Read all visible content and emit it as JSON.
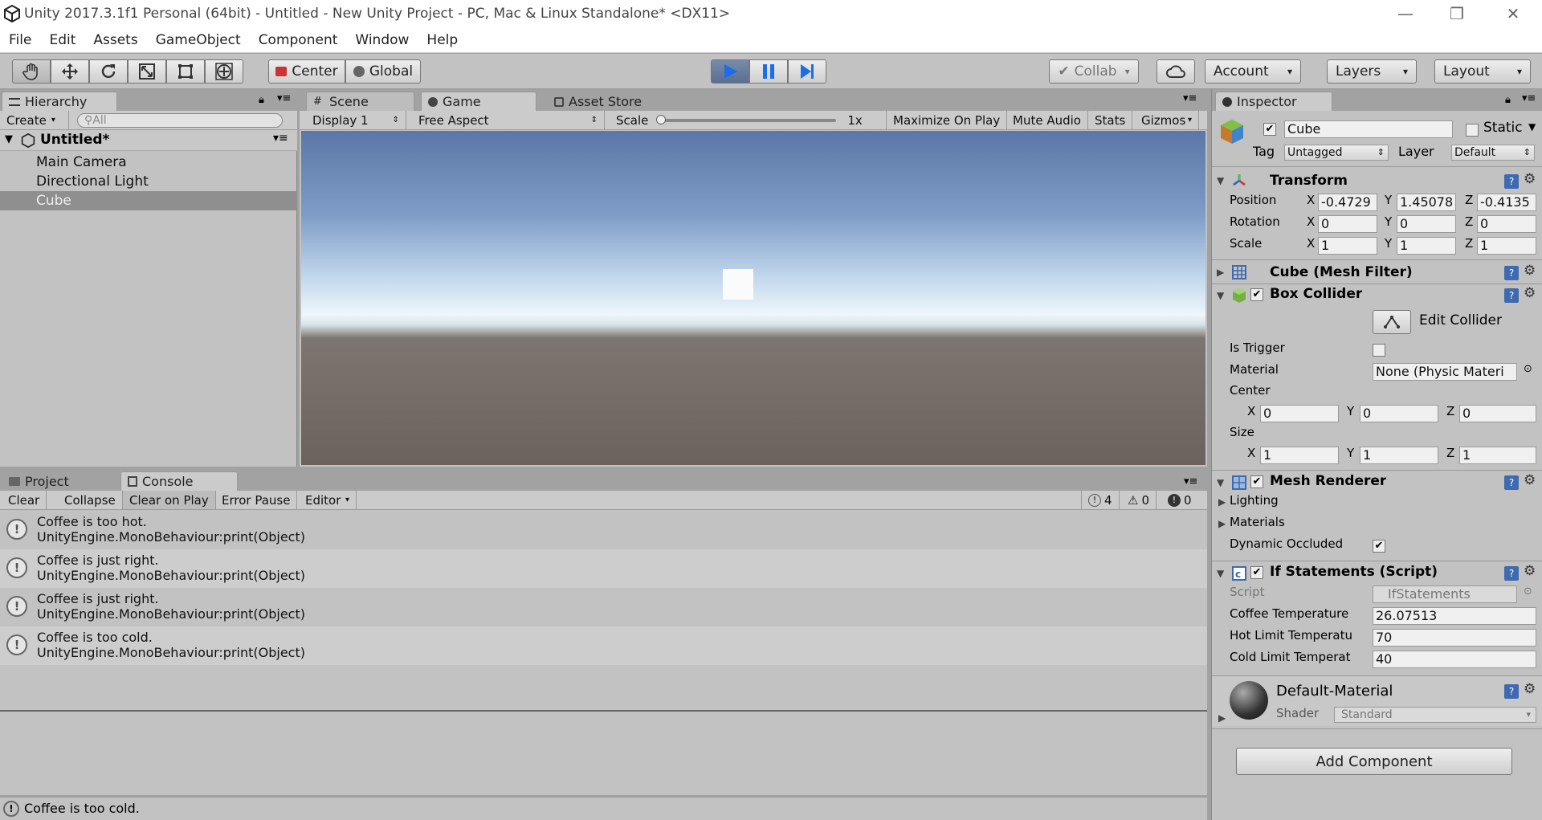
{
  "window": {
    "title": "Unity 2017.3.1f1 Personal (64bit) - Untitled - New Unity Project - PC, Mac & Linux Standalone* <DX11>",
    "minimize": "—",
    "restore": "❐",
    "close": "✕"
  },
  "menu": [
    "File",
    "Edit",
    "Assets",
    "GameObject",
    "Component",
    "Window",
    "Help"
  ],
  "toolbar": {
    "pivot": "Center",
    "space": "Global",
    "collab": "Collab",
    "account": "Account",
    "layers": "Layers",
    "layout": "Layout"
  },
  "hierarchy": {
    "tab": "Hierarchy",
    "create": "Create",
    "search_placeholder": "All",
    "scene": "Untitled*",
    "items": [
      "Main Camera",
      "Directional Light",
      "Cube"
    ]
  },
  "center_tabs": [
    "Scene",
    "Game",
    "Asset Store"
  ],
  "game": {
    "display": "Display 1",
    "aspect": "Free Aspect",
    "scale_label": "Scale",
    "scale_value": "1x",
    "maximize": "Maximize On Play",
    "mute": "Mute Audio",
    "stats": "Stats",
    "gizmos": "Gizmos"
  },
  "console": {
    "tabs": [
      "Project",
      "Console"
    ],
    "clear": "Clear",
    "collapse": "Collapse",
    "clear_on_play": "Clear on Play",
    "error_pause": "Error Pause",
    "editor": "Editor",
    "count_log": "4",
    "count_warn": "0",
    "count_err": "0",
    "entries": [
      {
        "msg": "Coffee is too hot.",
        "src": "UnityEngine.MonoBehaviour:print(Object)"
      },
      {
        "msg": "Coffee is just right.",
        "src": "UnityEngine.MonoBehaviour:print(Object)"
      },
      {
        "msg": "Coffee is just right.",
        "src": "UnityEngine.MonoBehaviour:print(Object)"
      },
      {
        "msg": "Coffee is too cold.",
        "src": "UnityEngine.MonoBehaviour:print(Object)"
      }
    ],
    "status": "Coffee is too cold."
  },
  "inspector": {
    "tab": "Inspector",
    "name": "Cube",
    "static": "Static",
    "tag_label": "Tag",
    "tag": "Untagged",
    "layer_label": "Layer",
    "layer": "Default",
    "transform": {
      "title": "Transform",
      "position_label": "Position",
      "px": "-0.4729",
      "py": "1.45078",
      "pz": "-0.4135",
      "rotation_label": "Rotation",
      "rx": "0",
      "ry": "0",
      "rz": "0",
      "scale_label": "Scale",
      "sx": "1",
      "sy": "1",
      "sz": "1"
    },
    "mesh_filter": "Cube (Mesh Filter)",
    "box_collider": {
      "title": "Box Collider",
      "edit": "Edit Collider",
      "is_trigger": "Is Trigger",
      "material_label": "Material",
      "material": "None (Physic Materi",
      "center_label": "Center",
      "cx": "0",
      "cy": "0",
      "cz": "0",
      "size_label": "Size",
      "szx": "1",
      "szy": "1",
      "szz": "1"
    },
    "mesh_renderer": {
      "title": "Mesh Renderer",
      "lighting": "Lighting",
      "materials": "Materials",
      "dynamic": "Dynamic Occluded"
    },
    "script": {
      "title": "If Statements (Script)",
      "script_label": "Script",
      "script": "IfStatements",
      "coffee_label": "Coffee Temperature",
      "coffee": "26.07513",
      "hot_label": "Hot Limit Temperatu",
      "hot": "70",
      "cold_label": "Cold Limit Temperat",
      "cold": "40"
    },
    "material": {
      "name": "Default-Material",
      "shader_label": "Shader",
      "shader": "Standard"
    },
    "add_component": "Add Component"
  },
  "axis": {
    "x": "X",
    "y": "Y",
    "z": "Z"
  }
}
